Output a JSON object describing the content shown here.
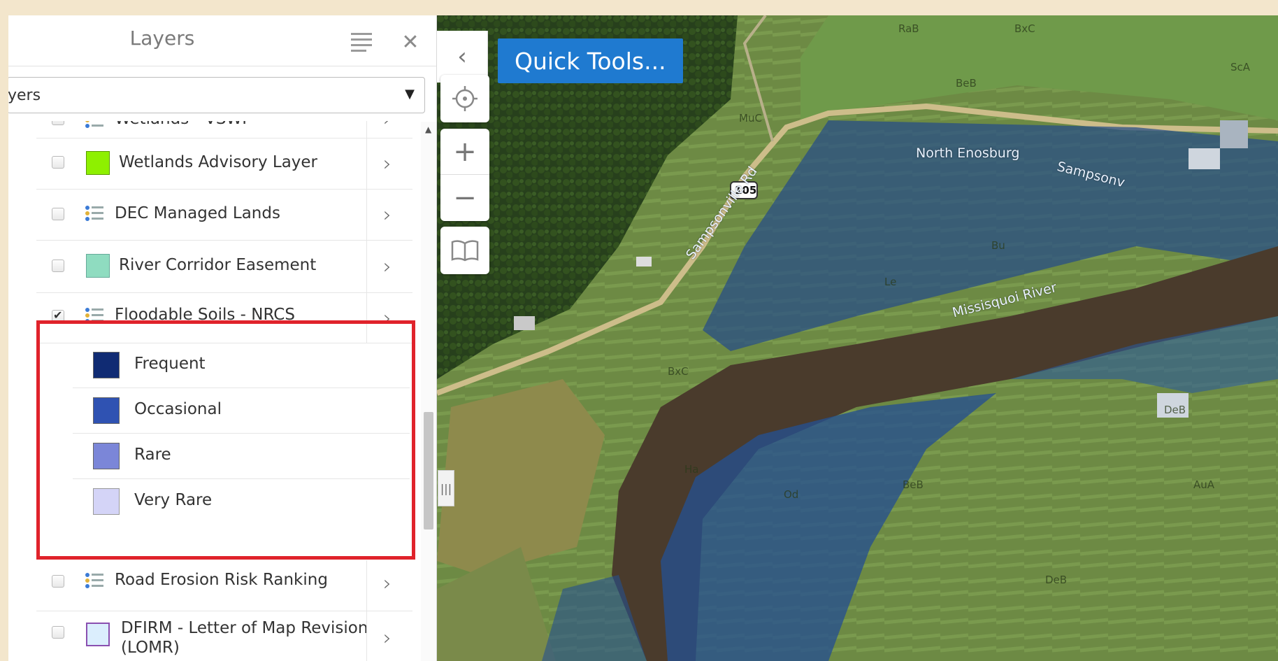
{
  "panel": {
    "title": "Layers",
    "select_value": "yers"
  },
  "layers": [
    {
      "label": "Wetlands - VSWI",
      "checked": false,
      "icon": "legend-list-icon"
    },
    {
      "label": "Wetlands Advisory Layer",
      "checked": false,
      "swatch": "#8ef000"
    },
    {
      "label": "DEC Managed Lands",
      "checked": false,
      "icon": "legend-list-icon"
    },
    {
      "label": "River Corridor Easement",
      "checked": false,
      "swatch": "#8fdcc0"
    },
    {
      "label": "Floodable Soils - NRCS",
      "checked": true,
      "icon": "legend-list-icon"
    },
    {
      "label": "Road Erosion Risk Ranking",
      "checked": false,
      "icon": "legend-list-icon"
    },
    {
      "label": "DFIRM - Letter of Map Revision",
      "label2": "(LOMR)",
      "checked": false,
      "swatch": "#dbeefd"
    }
  ],
  "floodable_legend": [
    {
      "label": "Frequent",
      "color": "#102b73"
    },
    {
      "label": "Occasional",
      "color": "#2f52b2"
    },
    {
      "label": "Rare",
      "color": "#7b86d8"
    },
    {
      "label": "Very Rare",
      "color": "#d4d4f7"
    }
  ],
  "map": {
    "quick_tools": "Quick Tools...",
    "route_shield": "105",
    "labels": {
      "road1": "Sampsonville Rd",
      "town": "North Enosburg",
      "road2": "Sampsonv",
      "river": "Missisquoi River"
    },
    "soil_codes": [
      "RaB",
      "BxC",
      "ScA",
      "BeB",
      "MuC",
      "Bu",
      "Le",
      "Ha",
      "Od",
      "BeB",
      "AuA",
      "DeB",
      "DeB",
      "BxC"
    ]
  },
  "colors": {
    "highlight": "#e0232b",
    "quick_tools_bg": "#1f7ad0"
  }
}
